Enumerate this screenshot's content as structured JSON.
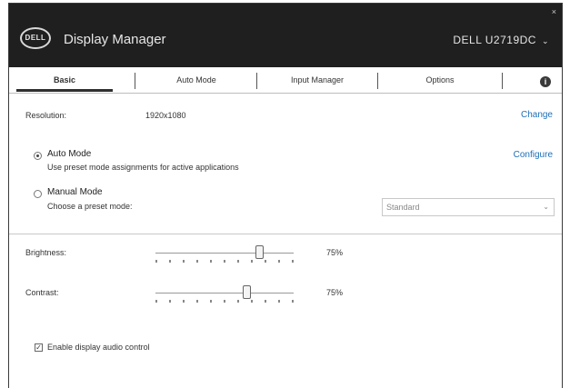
{
  "window": {
    "app_title": "Display Manager",
    "logo_text": "DELL",
    "close_symbol": "×",
    "monitor_name": "DELL U2719DC",
    "monitor_chevron": "⌄"
  },
  "tabs": [
    {
      "label": "Basic",
      "active": true
    },
    {
      "label": "Auto Mode",
      "active": false
    },
    {
      "label": "Input Manager",
      "active": false
    },
    {
      "label": "Options",
      "active": false
    }
  ],
  "info_symbol": "i",
  "resolution": {
    "label": "Resolution:",
    "value": "1920x1080",
    "action": "Change"
  },
  "auto_mode": {
    "title": "Auto Mode",
    "description": "Use preset mode assignments for active applications",
    "action": "Configure",
    "selected": true
  },
  "manual_mode": {
    "title": "Manual Mode",
    "description": "Choose a preset mode:",
    "preset_value": "Standard",
    "selected": false
  },
  "brightness": {
    "label": "Brightness:",
    "value_text": "75%",
    "value": 0.75
  },
  "contrast": {
    "label": "Contrast:",
    "value_text": "75%",
    "value": 0.66
  },
  "smart_control": {
    "label": "Enable display audio control",
    "checked": true,
    "check_symbol": "✓"
  },
  "colors": {
    "titlebar": "#1f1f1f",
    "link": "#1e6fb8"
  }
}
